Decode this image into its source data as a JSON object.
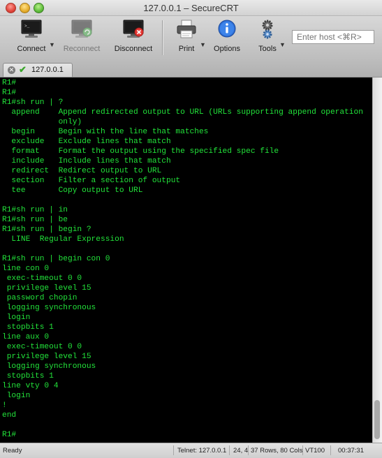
{
  "window": {
    "title": "127.0.0.1 – SecureCRT"
  },
  "toolbar": {
    "connect_label": "Connect",
    "reconnect_label": "Reconnect",
    "disconnect_label": "Disconnect",
    "print_label": "Print",
    "options_label": "Options",
    "tools_label": "Tools",
    "host_placeholder": "Enter host <⌘R>"
  },
  "tab": {
    "label": "127.0.0.1"
  },
  "terminal": {
    "lines": [
      "R1#",
      "R1#",
      "R1#sh run | ?",
      "  append    Append redirected output to URL (URLs supporting append operation",
      "            only)",
      "  begin     Begin with the line that matches",
      "  exclude   Exclude lines that match",
      "  format    Format the output using the specified spec file",
      "  include   Include lines that match",
      "  redirect  Redirect output to URL",
      "  section   Filter a section of output",
      "  tee       Copy output to URL",
      "",
      "R1#sh run | in",
      "R1#sh run | be",
      "R1#sh run | begin ?",
      "  LINE  Regular Expression",
      "",
      "R1#sh run | begin con 0",
      "line con 0",
      " exec-timeout 0 0",
      " privilege level 15",
      " password chopin",
      " logging synchronous",
      " login",
      " stopbits 1",
      "line aux 0",
      " exec-timeout 0 0",
      " privilege level 15",
      " logging synchronous",
      " stopbits 1",
      "line vty 0 4",
      " login",
      "!",
      "end",
      "",
      "R1#"
    ]
  },
  "status": {
    "state": "Ready",
    "connection": "Telnet: 127.0.0.1",
    "cursor": "24, 4",
    "size": "37 Rows, 80 Cols",
    "emulation": "VT100",
    "elapsed": "00:37:31"
  }
}
